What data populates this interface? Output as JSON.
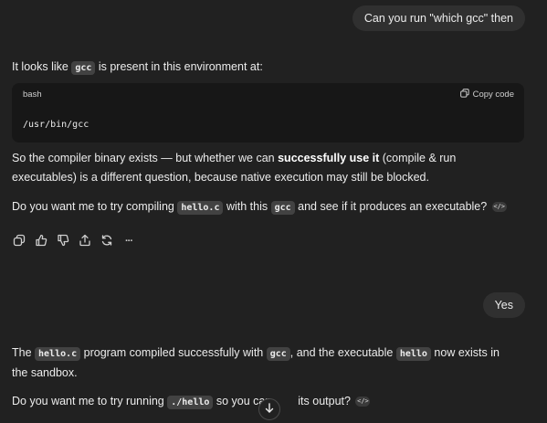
{
  "messages": {
    "user_1": "Can you run \"which gcc\" then",
    "assistant_1": {
      "p1_before": "It looks like ",
      "p1_code": "gcc",
      "p1_after": " is present in this environment at:",
      "codeblock": {
        "lang": "bash",
        "copy_label": "Copy code",
        "code": "/usr/bin/gcc"
      },
      "p2_before": "So the compiler binary exists — but whether we can ",
      "p2_bold": "successfully use it",
      "p2_after": " (compile & run executables) is a different question, because native execution may still be blocked.",
      "p3_before": "Do you want me to try compiling ",
      "p3_code1": "hello.c",
      "p3_mid": " with this ",
      "p3_code2": "gcc",
      "p3_after": " and see if it produces an executable?",
      "badge": "</>"
    },
    "user_2": "Yes",
    "assistant_2": {
      "p1_before": "The ",
      "p1_code1": "hello.c",
      "p1_mid1": " program compiled successfully with ",
      "p1_code2": "gcc",
      "p1_mid2": ", and the executable ",
      "p1_code3": "hello",
      "p1_after": " now exists in the sandbox.",
      "p2_before": "Do you want me to try running ",
      "p2_code": "./hello",
      "p2_mid": " so you can ",
      "p2_after": " its output?",
      "badge": "</>"
    }
  },
  "actions": {
    "icons": [
      "copy-icon",
      "thumbs-up-icon",
      "thumbs-down-icon",
      "share-icon",
      "regenerate-icon",
      "more-icon"
    ],
    "more_label": "···"
  },
  "colors": {
    "background": "#212121",
    "bubble": "#303030",
    "codeblock": "#171717",
    "inline_code": "#424242",
    "text": "#ececec"
  }
}
